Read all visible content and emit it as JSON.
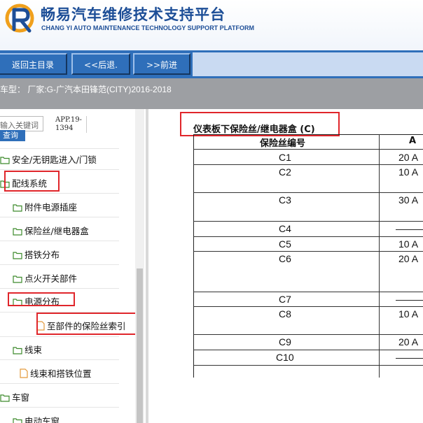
{
  "header": {
    "title": "畅易汽车维修技术支持平台",
    "subtitle": "CHANG YI AUTO MAINTENANCE TECHNOLOGY SUPPORT PLATFORM"
  },
  "toolbar": {
    "home_label": "返回主目录",
    "back_label": "<<后退.",
    "forward_label": ">>前进"
  },
  "model_bar": {
    "text": "车型： 厂家:G-广汽本田锋范(CITY)2016-2018"
  },
  "left_panel": {
    "search_placeholder": "输入关键词",
    "search_button": "查询",
    "app_version": "APP.19-1394",
    "tree": [
      {
        "label": "安全/无钥匙进入/门锁",
        "icon": "folder-icon"
      },
      {
        "label": "配线系统",
        "icon": "folder-open-icon"
      },
      {
        "label": "附件电源插座",
        "icon": "folder-icon"
      },
      {
        "label": "保险丝/继电器盒",
        "icon": "folder-icon"
      },
      {
        "label": "搭铁分布",
        "icon": "folder-icon"
      },
      {
        "label": "点火开关部件",
        "icon": "folder-icon"
      },
      {
        "label": "电源分布",
        "icon": "folder-open-icon"
      },
      {
        "label": "至部件的保险丝索引",
        "icon": "document-icon"
      },
      {
        "label": "线束",
        "icon": "folder-open-icon"
      },
      {
        "label": "线束和搭铁位置",
        "icon": "document-icon"
      },
      {
        "label": "车窗",
        "icon": "folder-open-icon"
      },
      {
        "label": "电动车窗",
        "icon": "folder-icon"
      }
    ]
  },
  "content": {
    "title": "仪表板下保险丝/继电器盒 (C)",
    "columns": [
      "保险丝编号",
      "A"
    ],
    "rows": [
      {
        "fuse": "C1",
        "amp": "20 A"
      },
      {
        "fuse": "C2",
        "amp": "10 A"
      },
      {
        "fuse": "C3",
        "amp": "30 A"
      },
      {
        "fuse": "C4",
        "amp": "———"
      },
      {
        "fuse": "C5",
        "amp": "10 A"
      },
      {
        "fuse": "C6",
        "amp": "20 A"
      },
      {
        "fuse": "C7",
        "amp": "———"
      },
      {
        "fuse": "C8",
        "amp": "10 A"
      },
      {
        "fuse": "C9",
        "amp": "20 A"
      },
      {
        "fuse": "C10",
        "amp": "———"
      }
    ]
  }
}
